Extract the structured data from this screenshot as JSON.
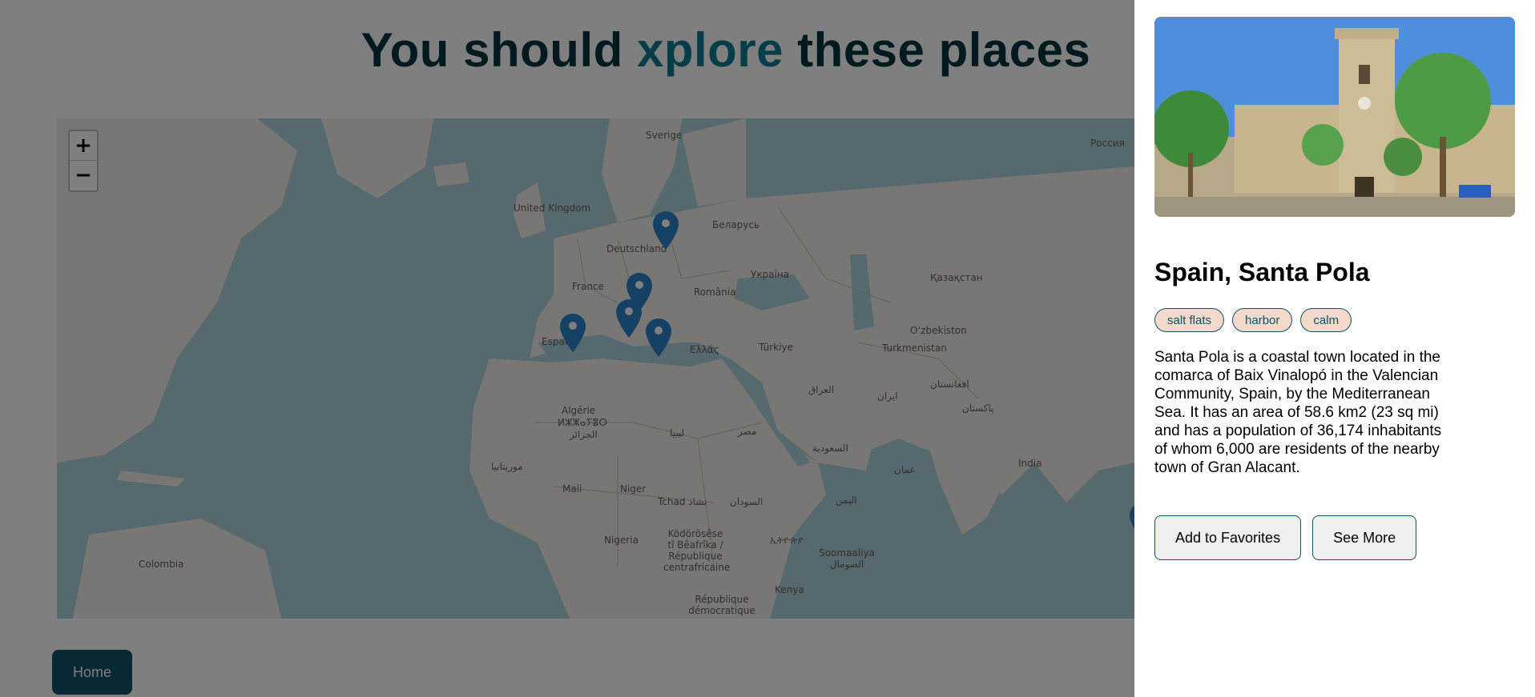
{
  "header": {
    "title_before": "You should ",
    "title_accent": "xplore",
    "title_after": " these places"
  },
  "map": {
    "zoom_in_label": "+",
    "zoom_out_label": "−",
    "labels": [
      "Sverige",
      "Россия",
      "United Kingdom",
      "Беларусь",
      "Deutschland",
      "France",
      "Україна",
      "România",
      "Қазақстан",
      "Españ",
      "Ελλάς",
      "Türkiye",
      "Oʻzbekiston",
      "Turkmenistan",
      "Algérie",
      "ⵍⵣⵣⴰⵢⴻⵔ",
      "الجزائر",
      "ليبيا",
      "مصر",
      "العراق",
      "ایران",
      "افغانستان",
      "پاکستان",
      "موريتانيا",
      "Mali",
      "Niger",
      "Tchad تشاد",
      "السودان",
      "السعودية",
      "عمان",
      "India",
      "اليمن",
      "Nigeria",
      "Ködörösêse tî Bêafrîka / République centrafricaine",
      "ኢትዮጵያ",
      "Soomaaliya الصومال",
      "Colombia",
      "Kenya",
      "République démocratique"
    ],
    "marker_count": 6
  },
  "nav": {
    "home_label": "Home"
  },
  "drawer": {
    "photo_icon": "town-photo",
    "title": "Spain, Santa Pola",
    "tags": [
      "salt flats",
      "harbor",
      "calm"
    ],
    "description": "Santa Pola is a coastal town located in the comarca of Baix Vinalopó in the Valencian Community, Spain, by the Mediterranean Sea. It has an area of 58.6 km2 (23 sq mi) and has a population of 36,174 inhabitants of whom 6,000 are residents of the nearby town of Gran Alacant.",
    "add_favorites_label": "Add to Favorites",
    "see_more_label": "See More"
  },
  "colors": {
    "brand_dark": "#003441",
    "brand_accent": "#0d7a92",
    "button_primary": "#0d5266",
    "tag_bg": "#f3d9c9",
    "map_sea": "#aad3df",
    "map_land": "#f2efe9"
  }
}
